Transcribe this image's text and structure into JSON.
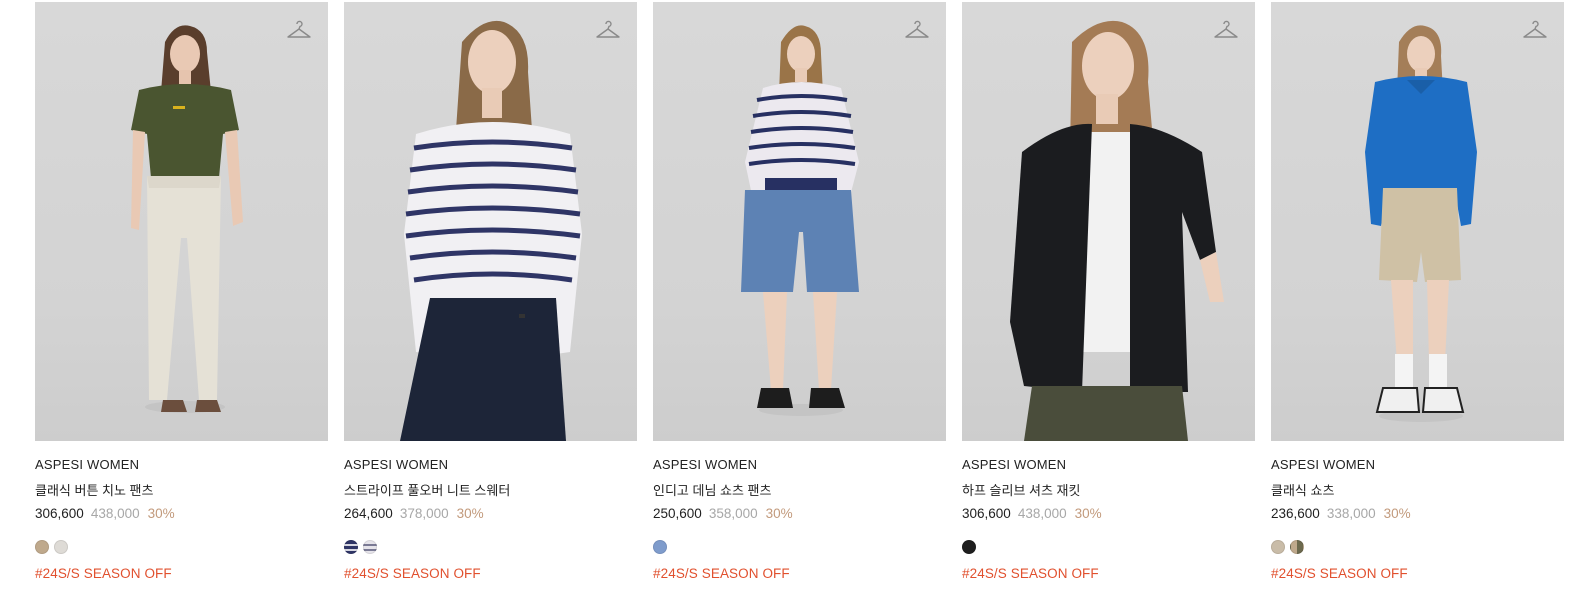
{
  "products": [
    {
      "brand": "ASPESI WOMEN",
      "name": "클래식 버튼 치노 팬츠",
      "price": "306,600",
      "original_price": "438,000",
      "discount": "30%",
      "swatches": [
        "#bfa98c",
        "#dedbd6"
      ],
      "tag": "#24S/S SEASON OFF",
      "wishlist_icon": "hanger-icon"
    },
    {
      "brand": "ASPESI WOMEN",
      "name": "스트라이프 풀오버 니트 스웨터",
      "price": "264,600",
      "original_price": "378,000",
      "discount": "30%",
      "swatches": [
        "stripe-navy",
        "stripe-light"
      ],
      "tag": "#24S/S SEASON OFF",
      "wishlist_icon": "hanger-icon"
    },
    {
      "brand": "ASPESI WOMEN",
      "name": "인디고 데님 쇼츠 팬츠",
      "price": "250,600",
      "original_price": "358,000",
      "discount": "30%",
      "swatches": [
        "#7f9ccc"
      ],
      "tag": "#24S/S SEASON OFF",
      "wishlist_icon": "hanger-icon"
    },
    {
      "brand": "ASPESI WOMEN",
      "name": "하프 슬리브 셔츠 재킷",
      "price": "306,600",
      "original_price": "438,000",
      "discount": "30%",
      "swatches": [
        "#1e1e1e"
      ],
      "tag": "#24S/S SEASON OFF",
      "wishlist_icon": "hanger-icon"
    },
    {
      "brand": "ASPESI WOMEN",
      "name": "클래식 쇼츠",
      "price": "236,600",
      "original_price": "338,000",
      "discount": "30%",
      "swatches": [
        "#c9bca8",
        "split-beige-olive"
      ],
      "tag": "#24S/S SEASON OFF",
      "wishlist_icon": "hanger-icon"
    }
  ],
  "colors": {
    "tag": "#e1502e",
    "discount": "#c29a7c",
    "original_price": "#a7a7a7",
    "thumb_bg": "#d6d6d6"
  }
}
